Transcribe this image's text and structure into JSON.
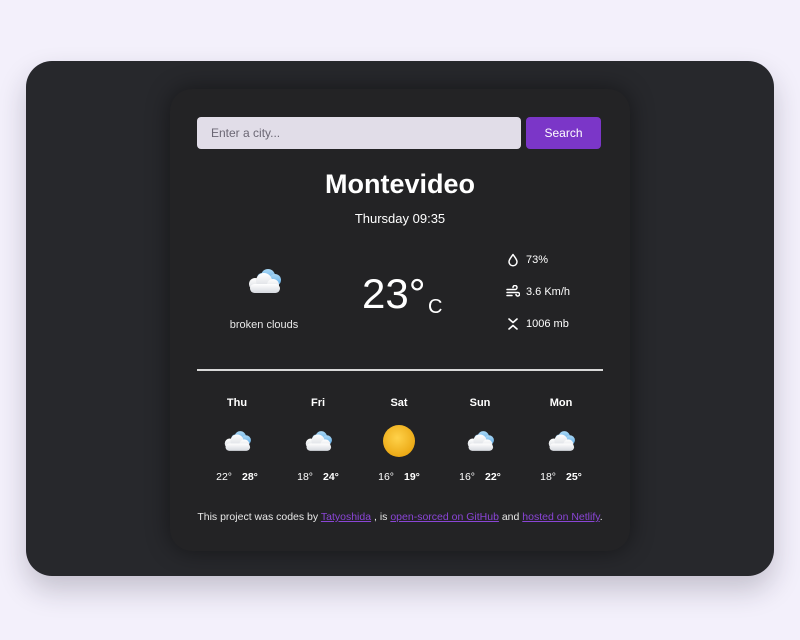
{
  "search": {
    "placeholder": "Enter a city...",
    "button_label": "Search"
  },
  "current": {
    "city": "Montevideo",
    "datetime": "Thursday 09:35",
    "icon": "broken-clouds-icon",
    "description": "broken clouds",
    "temperature": "23°",
    "unit": "C",
    "humidity": "73%",
    "wind": "3.6 Km/h",
    "pressure": "1006 mb"
  },
  "forecast": [
    {
      "day": "Thu",
      "icon": "cloud-icon",
      "min": "22°",
      "max": "28°"
    },
    {
      "day": "Fri",
      "icon": "cloud-icon",
      "min": "18°",
      "max": "24°"
    },
    {
      "day": "Sat",
      "icon": "sun-icon",
      "min": "16°",
      "max": "19°"
    },
    {
      "day": "Sun",
      "icon": "cloud-icon",
      "min": "16°",
      "max": "22°"
    },
    {
      "day": "Mon",
      "icon": "cloud-icon",
      "min": "18°",
      "max": "25°"
    }
  ],
  "footer": {
    "prefix": "This project was codes by ",
    "author": "Tatyoshida",
    "middle": " , is ",
    "github_link": "open-sorced on GitHub",
    "and": " and ",
    "netlify_link": "hosted on Netlify",
    "suffix": "."
  },
  "colors": {
    "accent": "#7b36c8",
    "card": "#232325",
    "outer": "#27282c",
    "background": "#f3f0fb",
    "sun": "#f2b21b"
  }
}
